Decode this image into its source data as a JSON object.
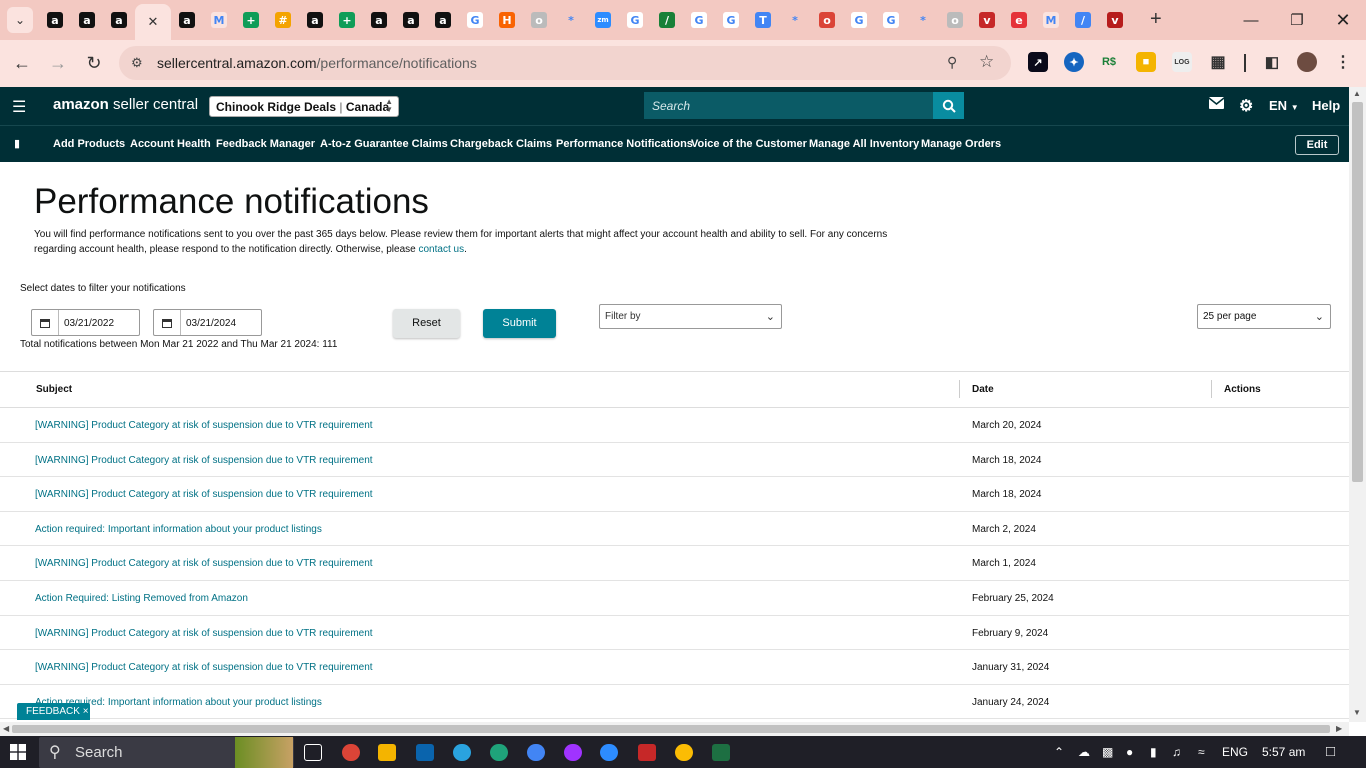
{
  "browser": {
    "url_host": "sellercentral.amazon.com",
    "url_path": "/performance/notifications",
    "tab_favicons": [
      "amazon-icon",
      "amazon-icon",
      "amazon-icon",
      "active-tab",
      "amazon-icon",
      "gmail-icon",
      "sheets-icon",
      "tag-icon",
      "amazon-icon",
      "sheets-icon",
      "amazon-icon",
      "amazon-icon",
      "amazon-icon",
      "google-icon",
      "home-depot-icon",
      "globe-icon",
      "puzzle-icon",
      "zoom-icon",
      "google-icon",
      "sheets-chart-icon",
      "google-icon",
      "google-icon",
      "translate-icon",
      "puzzle-icon",
      "chrome-icon",
      "google-icon",
      "google-icon",
      "puzzle-icon",
      "globe-icon",
      "shop-icon",
      "ebay-icon",
      "gmail-icon",
      "sheet-icon",
      "shield-icon"
    ]
  },
  "header": {
    "logo_amazon": "amazon",
    "logo_rest": " seller central",
    "store_name": "Chinook Ridge Deals",
    "store_sep": " | ",
    "store_region": "Canada",
    "search_placeholder": "Search",
    "language": "EN",
    "help": "Help"
  },
  "subnav": {
    "items": [
      "Add Products",
      "Account Health",
      "Feedback Manager",
      "A-to-z Guarantee Claims",
      "Chargeback Claims",
      "Performance Notifications",
      "Voice of the Customer",
      "Manage All Inventory",
      "Manage Orders"
    ],
    "edit": "Edit"
  },
  "page": {
    "title": "Performance notifications",
    "intro_text": "You will find performance notifications sent to you over the past 365 days below. Please review them for important alerts that might affect your account health and ability to sell. For any concerns regarding account health, please respond to the notification directly. Otherwise, please ",
    "contact_link": "contact us",
    "intro_end": ".",
    "filter_label": "Select dates to filter your notifications",
    "start_date": "03/21/2022",
    "end_date": "03/21/2024",
    "reset": "Reset",
    "submit": "Submit",
    "filter_by": "Filter by",
    "per_page": "25 per page",
    "total_line": "Total notifications between Mon Mar 21 2022 and Thu Mar 21 2024: 111"
  },
  "table": {
    "headers": {
      "subject": "Subject",
      "date": "Date",
      "actions": "Actions"
    },
    "rows": [
      {
        "subject": "[WARNING] Product Category at risk of suspension due to VTR requirement",
        "date": "March 20, 2024"
      },
      {
        "subject": "[WARNING] Product Category at risk of suspension due to VTR requirement",
        "date": "March 18, 2024"
      },
      {
        "subject": "[WARNING] Product Category at risk of suspension due to VTR requirement",
        "date": "March 18, 2024"
      },
      {
        "subject": "Action required: Important information about your product listings",
        "date": "March 2, 2024"
      },
      {
        "subject": "[WARNING] Product Category at risk of suspension due to VTR requirement",
        "date": "March 1, 2024"
      },
      {
        "subject": "Action Required: Listing Removed from Amazon",
        "date": "February 25, 2024"
      },
      {
        "subject": "[WARNING] Product Category at risk of suspension due to VTR requirement",
        "date": "February 9, 2024"
      },
      {
        "subject": "[WARNING] Product Category at risk of suspension due to VTR requirement",
        "date": "January 31, 2024"
      },
      {
        "subject": "Action required: Important information about your product listings",
        "date": "January 24, 2024"
      }
    ]
  },
  "feedback": "FEEDBACK",
  "taskbar": {
    "search": "Search",
    "lang": "ENG",
    "time": "5:57 am"
  },
  "colors": {
    "header_bg": "#002f36",
    "link": "#007185",
    "submit": "#008296",
    "tabbar": "#f3c9c2"
  }
}
